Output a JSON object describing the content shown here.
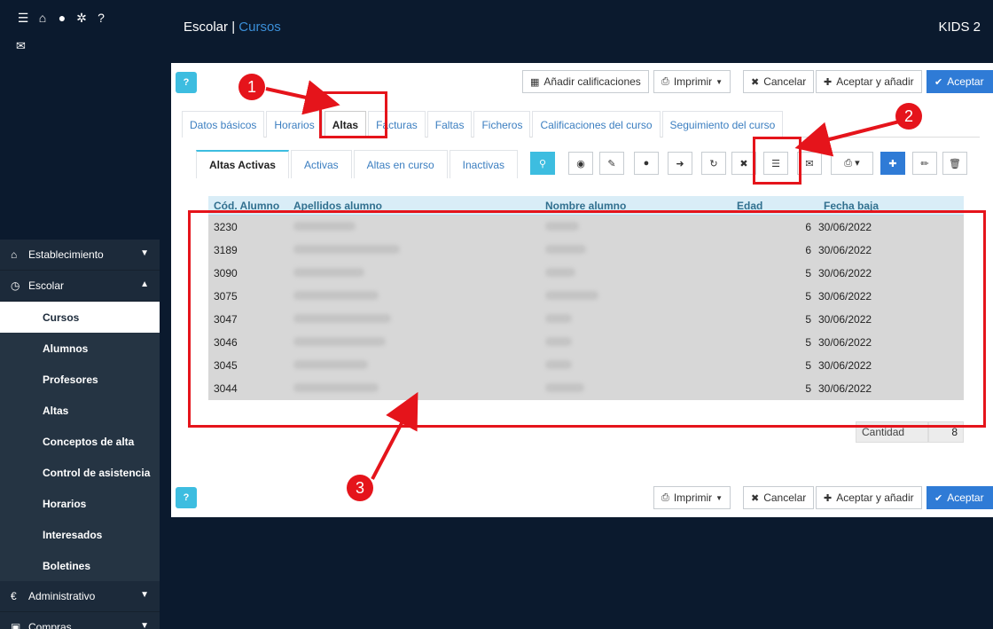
{
  "header": {
    "crumb_main": "Escolar",
    "crumb_sep": "|",
    "crumb_link": "Cursos",
    "brand": "KIDS 2"
  },
  "sidebar": {
    "icons": [
      "list-icon",
      "home-icon",
      "user-icon",
      "gear-icon",
      "help-icon",
      "chat-icon"
    ],
    "sections": [
      {
        "label": "Establecimiento",
        "icon": "home-icon",
        "expanded": false
      },
      {
        "label": "Escolar",
        "icon": "clock-icon",
        "expanded": true
      },
      {
        "label": "Administrativo",
        "icon": "euro-icon",
        "expanded": false
      },
      {
        "label": "Compras",
        "icon": "bag-icon",
        "expanded": false
      }
    ],
    "sub_items": [
      "Cursos",
      "Alumnos",
      "Profesores",
      "Altas",
      "Conceptos de alta",
      "Control de asistencia",
      "Horarios",
      "Interesados",
      "Boletines"
    ],
    "active_sub": "Cursos"
  },
  "toolbar_top": {
    "add_grades": "Añadir calificaciones",
    "print": "Imprimir",
    "cancel": "Cancelar",
    "accept_add": "Aceptar y añadir",
    "accept": "Aceptar"
  },
  "tabs": [
    "Datos básicos",
    "Horarios",
    "Altas",
    "Facturas",
    "Faltas",
    "Ficheros",
    "Calificaciones del curso",
    "Seguimiento del curso"
  ],
  "active_tab": "Altas",
  "subtabs": [
    "Altas Activas",
    "Activas",
    "Altas en curso",
    "Inactivas"
  ],
  "active_subtab": "Altas Activas",
  "table": {
    "columns": [
      "Cód. Alumno",
      "Apellidos alumno",
      "Nombre alumno",
      "Edad",
      "Fecha baja"
    ],
    "rows": [
      {
        "code": "3230",
        "age": "6",
        "date": "30/06/2022"
      },
      {
        "code": "3189",
        "age": "6",
        "date": "30/06/2022"
      },
      {
        "code": "3090",
        "age": "5",
        "date": "30/06/2022"
      },
      {
        "code": "3075",
        "age": "5",
        "date": "30/06/2022"
      },
      {
        "code": "3047",
        "age": "5",
        "date": "30/06/2022"
      },
      {
        "code": "3046",
        "age": "5",
        "date": "30/06/2022"
      },
      {
        "code": "3045",
        "age": "5",
        "date": "30/06/2022"
      },
      {
        "code": "3044",
        "age": "5",
        "date": "30/06/2022"
      }
    ]
  },
  "quantity": {
    "label": "Cantidad",
    "value": "8"
  },
  "annotations": [
    "1",
    "2",
    "3"
  ],
  "colors": {
    "accent": "#2f7bd6",
    "info": "#3dbde0",
    "annotation": "#e5141b",
    "nav": "#0b1a2e"
  }
}
